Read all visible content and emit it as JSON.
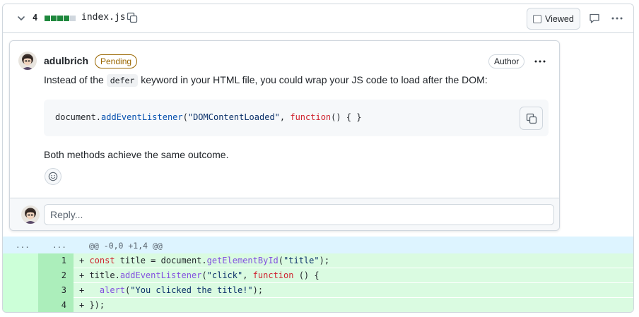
{
  "file_header": {
    "changes_count": "4",
    "diffstat": [
      "add",
      "add",
      "add",
      "add",
      "neutral"
    ],
    "filename": "index.js",
    "viewed_label": "Viewed",
    "icons": {
      "collapse": "chevron-down-icon",
      "copy": "copy-icon",
      "comment": "comment-icon",
      "more": "kebab-horizontal-icon"
    }
  },
  "comment": {
    "username": "adulbrich",
    "pending_label": "Pending",
    "author_label": "Author",
    "text_before": "Instead of the ",
    "inline_code": "defer",
    "text_after": " keyword in your HTML file, you could wrap your JS code to load after the DOM:",
    "code_obj": "document.",
    "code_method": "addEventListener",
    "code_open": "(",
    "code_string": "\"DOMContentLoaded\"",
    "code_sep": ", ",
    "code_keyword": "function",
    "code_end": "() { }",
    "closing_text": "Both methods achieve the same outcome.",
    "reply_placeholder": "Reply..."
  },
  "diff": {
    "hunk_left": "...",
    "hunk_right": "...",
    "hunk_header": "@@ -0,0 +1,4 @@",
    "lines": [
      {
        "num": "1",
        "prefix": "+ ",
        "tokens": [
          {
            "c": "kw",
            "t": "const"
          },
          {
            "c": "",
            "t": " title = document."
          },
          {
            "c": "fn",
            "t": "getElementById"
          },
          {
            "c": "",
            "t": "("
          },
          {
            "c": "st",
            "t": "\"title\""
          },
          {
            "c": "",
            "t": ");"
          }
        ]
      },
      {
        "num": "2",
        "prefix": "+ ",
        "tokens": [
          {
            "c": "",
            "t": "title."
          },
          {
            "c": "fn",
            "t": "addEventListener"
          },
          {
            "c": "",
            "t": "("
          },
          {
            "c": "st",
            "t": "\"click\""
          },
          {
            "c": "",
            "t": ", "
          },
          {
            "c": "kw",
            "t": "function"
          },
          {
            "c": "",
            "t": " () {"
          }
        ]
      },
      {
        "num": "3",
        "prefix": "+ ",
        "tokens": [
          {
            "c": "",
            "t": "  "
          },
          {
            "c": "fn",
            "t": "alert"
          },
          {
            "c": "",
            "t": "("
          },
          {
            "c": "st",
            "t": "\"You clicked the title!\""
          },
          {
            "c": "",
            "t": ");"
          }
        ]
      },
      {
        "num": "4",
        "prefix": "+ ",
        "tokens": [
          {
            "c": "",
            "t": "});"
          }
        ]
      }
    ]
  },
  "colors": {
    "addition": "#1f883d",
    "pending": "#9a6700",
    "hunk_bg": "#ddf4ff",
    "add_bg": "#dafbe1",
    "add_gutter": "#aceebb"
  }
}
